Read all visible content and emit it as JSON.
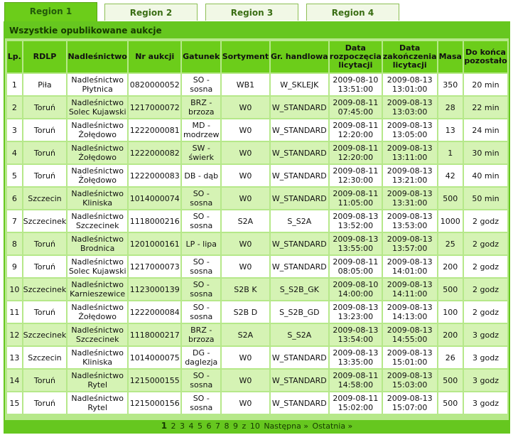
{
  "tabs": [
    "Region 1",
    "Region 2",
    "Region 3",
    "Region 4"
  ],
  "panel_title": "Wszystkie opublikowane aukcje",
  "columns": [
    "Lp.",
    "RDLP",
    "Nadleśnictwo",
    "Nr aukcji",
    "Gatunek",
    "Sortyment",
    "Gr. handlowa",
    "Data rozpoczęcia licytacji",
    "Data zakończenia licytacji",
    "Masa",
    "Do końca pozostało"
  ],
  "rows": [
    [
      "1",
      "Piła",
      "Nadleśnictwo Płytnica",
      "0820000052",
      "SO - sosna",
      "WB1",
      "W_SKLEJK",
      "2009-08-10 13:51:00",
      "2009-08-13 13:01:00",
      "350",
      "20 min"
    ],
    [
      "2",
      "Toruń",
      "Nadleśnictwo Solec Kujawski",
      "1217000072",
      "BRZ - brzoza",
      "W0",
      "W_STANDARD",
      "2009-08-11 07:45:00",
      "2009-08-13 13:03:00",
      "28",
      "22 min"
    ],
    [
      "3",
      "Toruń",
      "Nadleśnictwo Żołędowo",
      "1222000081",
      "MD - modrzew",
      "W0",
      "W_STANDARD",
      "2009-08-11 12:20:00",
      "2009-08-13 13:05:00",
      "13",
      "24 min"
    ],
    [
      "4",
      "Toruń",
      "Nadleśnictwo Żołędowo",
      "1222000082",
      "SW - świerk",
      "W0",
      "W_STANDARD",
      "2009-08-11 12:20:00",
      "2009-08-13 13:11:00",
      "1",
      "30 min"
    ],
    [
      "5",
      "Toruń",
      "Nadleśnictwo Żołędowo",
      "1222000083",
      "DB - dąb",
      "W0",
      "W_STANDARD",
      "2009-08-11 12:30:00",
      "2009-08-13 13:21:00",
      "42",
      "40 min"
    ],
    [
      "6",
      "Szczecin",
      "Nadleśnictwo Kliniska",
      "1014000074",
      "SO - sosna",
      "W0",
      "W_STANDARD",
      "2009-08-11 11:05:00",
      "2009-08-13 13:31:00",
      "500",
      "50 min"
    ],
    [
      "7",
      "Szczecinek",
      "Nadleśnictwo Szczecinek",
      "1118000216",
      "SO - sosna",
      "S2A",
      "S_S2A",
      "2009-08-13 13:52:00",
      "2009-08-13 13:53:00",
      "1000",
      "2 godz"
    ],
    [
      "8",
      "Toruń",
      "Nadleśnictwo Brodnica",
      "1201000161",
      "LP - lipa",
      "W0",
      "W_STANDARD",
      "2009-08-13 13:55:00",
      "2009-08-13 13:57:00",
      "25",
      "2 godz"
    ],
    [
      "9",
      "Toruń",
      "Nadleśnictwo Solec Kujawski",
      "1217000073",
      "SO - sosna",
      "W0",
      "W_STANDARD",
      "2009-08-11 08:05:00",
      "2009-08-13 14:01:00",
      "200",
      "2 godz"
    ],
    [
      "10",
      "Szczecinek",
      "Nadleśnictwo Karnieszewice",
      "1123000139",
      "SO - sosna",
      "S2B K",
      "S_S2B_GK",
      "2009-08-10 14:00:00",
      "2009-08-13 14:11:00",
      "500",
      "2 godz"
    ],
    [
      "11",
      "Toruń",
      "Nadleśnictwo Żołędowo",
      "1222000084",
      "SO - sosna",
      "S2B D",
      "S_S2B_GD",
      "2009-08-13 13:23:00",
      "2009-08-13 14:13:00",
      "100",
      "2 godz"
    ],
    [
      "12",
      "Szczecinek",
      "Nadleśnictwo Szczecinek",
      "1118000217",
      "BRZ - brzoza",
      "S2A",
      "S_S2A",
      "2009-08-13 13:54:00",
      "2009-08-13 14:55:00",
      "200",
      "3 godz"
    ],
    [
      "13",
      "Szczecin",
      "Nadleśnictwo Kliniska",
      "1014000075",
      "DG - daglezja",
      "W0",
      "W_STANDARD",
      "2009-08-13 13:35:00",
      "2009-08-13 15:01:00",
      "26",
      "3 godz"
    ],
    [
      "14",
      "Toruń",
      "Nadleśnictwo Rytel",
      "1215000155",
      "SO - sosna",
      "W0",
      "W_STANDARD",
      "2009-08-11 14:58:00",
      "2009-08-13 15:03:00",
      "500",
      "3 godz"
    ],
    [
      "15",
      "Toruń",
      "Nadleśnictwo Rytel",
      "1215000156",
      "SO - sosna",
      "W0",
      "W_STANDARD",
      "2009-08-11 15:02:00",
      "2009-08-13 15:07:00",
      "500",
      "3 godz"
    ]
  ],
  "pagination": {
    "current": "1",
    "pages": [
      "2",
      "3",
      "4",
      "5",
      "6",
      "7",
      "8",
      "9"
    ],
    "of_label": "z",
    "total": "10",
    "next": "Następna »",
    "last": "Ostatnia »"
  },
  "colors": {
    "accent": "#66c71f",
    "header": "#6ccd1a",
    "panel_bg": "#b6e88a",
    "row_alt": "#d5f3b4"
  }
}
